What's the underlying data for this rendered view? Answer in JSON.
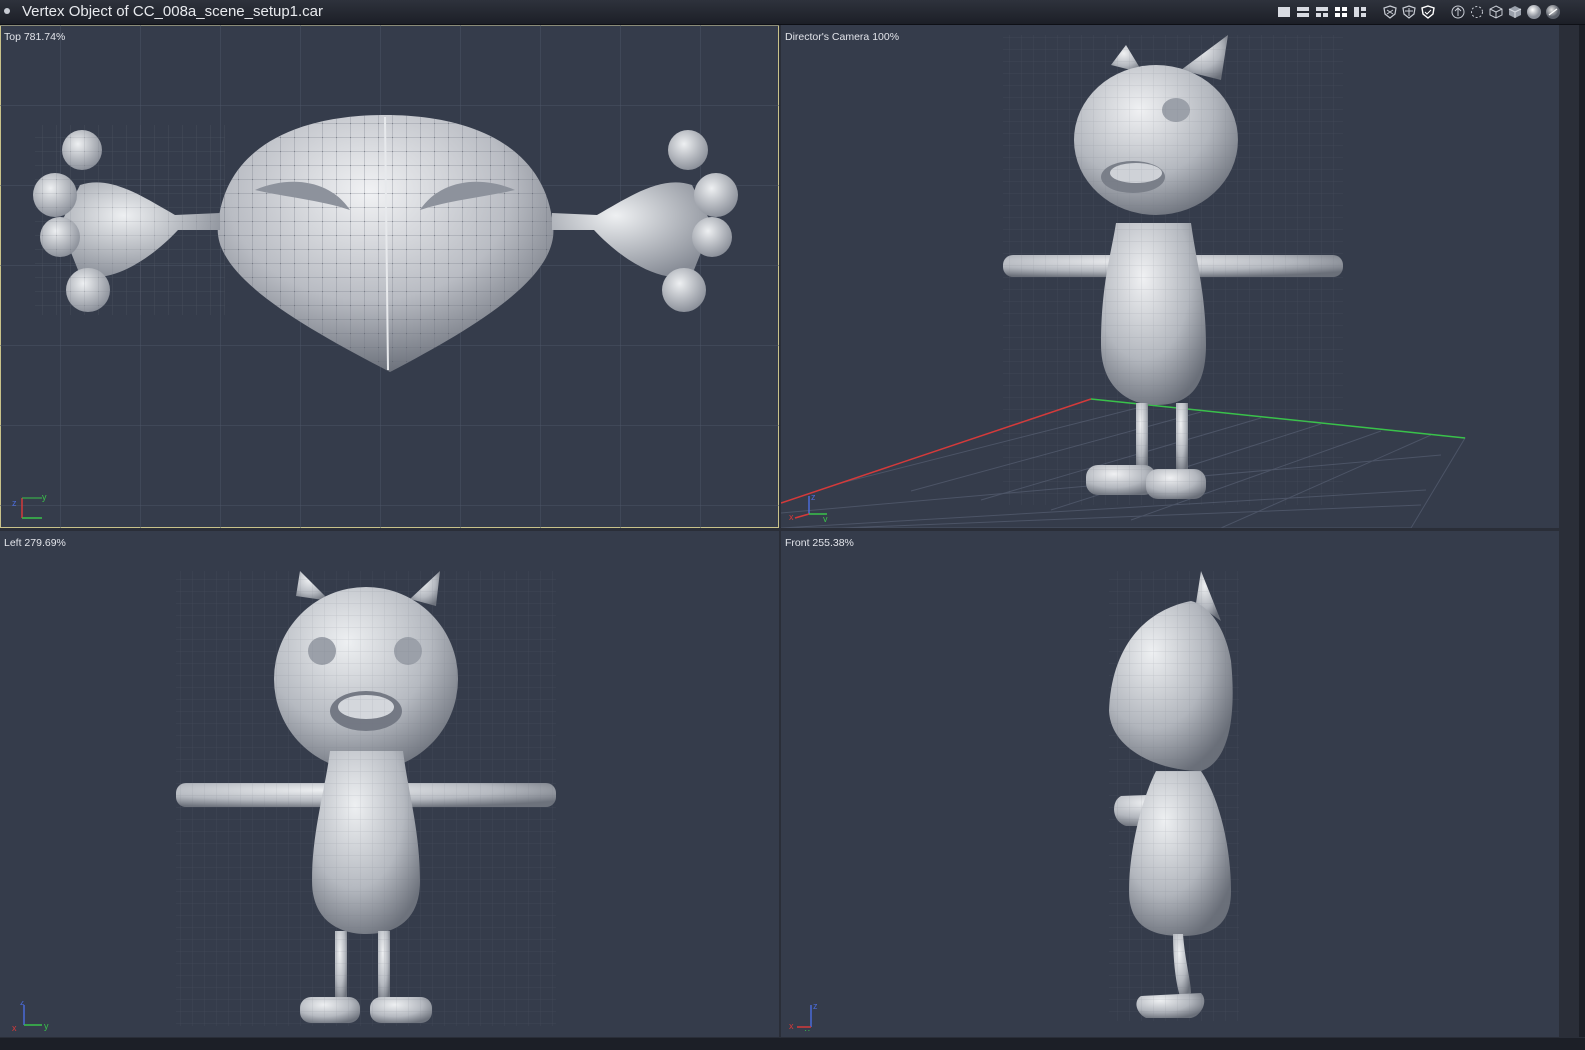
{
  "window": {
    "title": "Vertex Object of CC_008a_scene_setup1.car"
  },
  "toolbar": {
    "buttons": [
      {
        "name": "layout-single-icon"
      },
      {
        "name": "layout-two-horizontal-icon"
      },
      {
        "name": "layout-three-icon"
      },
      {
        "name": "layout-four-icon"
      },
      {
        "name": "layout-custom-icon"
      },
      {
        "name": "shield-wire-icon"
      },
      {
        "name": "shield-solid-icon"
      },
      {
        "name": "shield-check-icon"
      },
      {
        "name": "shading-point-icon"
      },
      {
        "name": "shading-vertex-icon"
      },
      {
        "name": "shading-wire-icon"
      },
      {
        "name": "shading-solid-icon"
      },
      {
        "name": "shading-smooth-icon"
      },
      {
        "name": "shading-render-icon"
      }
    ]
  },
  "viewports": {
    "top": {
      "label": "Top 781.74%"
    },
    "camera": {
      "label": "Director's Camera 100%"
    },
    "left": {
      "label": "Left 279.69%"
    },
    "front": {
      "label": "Front 255.38%"
    }
  },
  "axes": {
    "x_label": "x",
    "y_label": "y",
    "z_label": "z"
  },
  "colors": {
    "viewport_bg": "#353c4b",
    "model": "#c9ccd2",
    "wire": "#6e7380",
    "grid": "#4c5466",
    "axis_x": "#d43a3a",
    "axis_y": "#39c24a",
    "axis_z": "#4a6ad8",
    "active_border": "#c9c28a"
  }
}
